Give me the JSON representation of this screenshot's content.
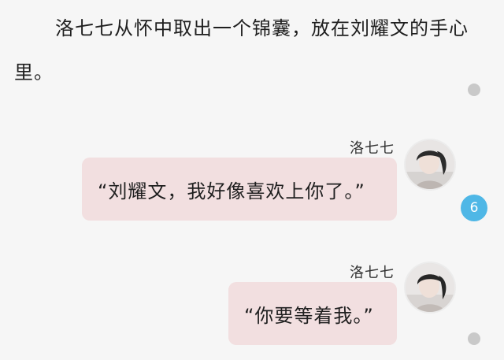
{
  "narration": {
    "text": "洛七七从怀中取出一个锦囊，放在刘耀文的手心里。"
  },
  "messages": [
    {
      "sender": "洛七七",
      "text": "“刘耀文，我好像喜欢上你了。”"
    },
    {
      "sender": "洛七七",
      "text": "“你要等着我。”"
    }
  ],
  "comment_badge": {
    "count": "6",
    "color": "#4fb7e6"
  },
  "colors": {
    "bubble": "#f2dfe0",
    "background": "#f6f6f6"
  }
}
